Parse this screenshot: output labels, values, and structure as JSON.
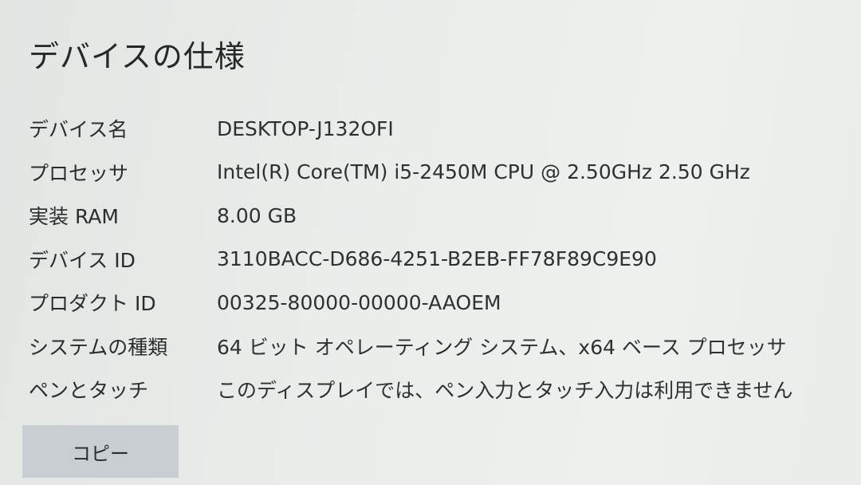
{
  "page_title": "デバイスの仕様",
  "specs": [
    {
      "label": "デバイス名",
      "value": "DESKTOP-J132OFI"
    },
    {
      "label": "プロセッサ",
      "value": "Intel(R) Core(TM) i5-2450M CPU @ 2.50GHz   2.50 GHz"
    },
    {
      "label": "実装 RAM",
      "value": "8.00 GB"
    },
    {
      "label": "デバイス ID",
      "value": "3110BACC-D686-4251-B2EB-FF78F89C9E90"
    },
    {
      "label": "プロダクト ID",
      "value": "00325-80000-00000-AAOEM"
    },
    {
      "label": "システムの種類",
      "value": "64 ビット オペレーティング システム、x64 ベース プロセッサ"
    },
    {
      "label": "ペンとタッチ",
      "value": "このディスプレイでは、ペン入力とタッチ入力は利用できません"
    }
  ],
  "copy_button_label": "コピー"
}
